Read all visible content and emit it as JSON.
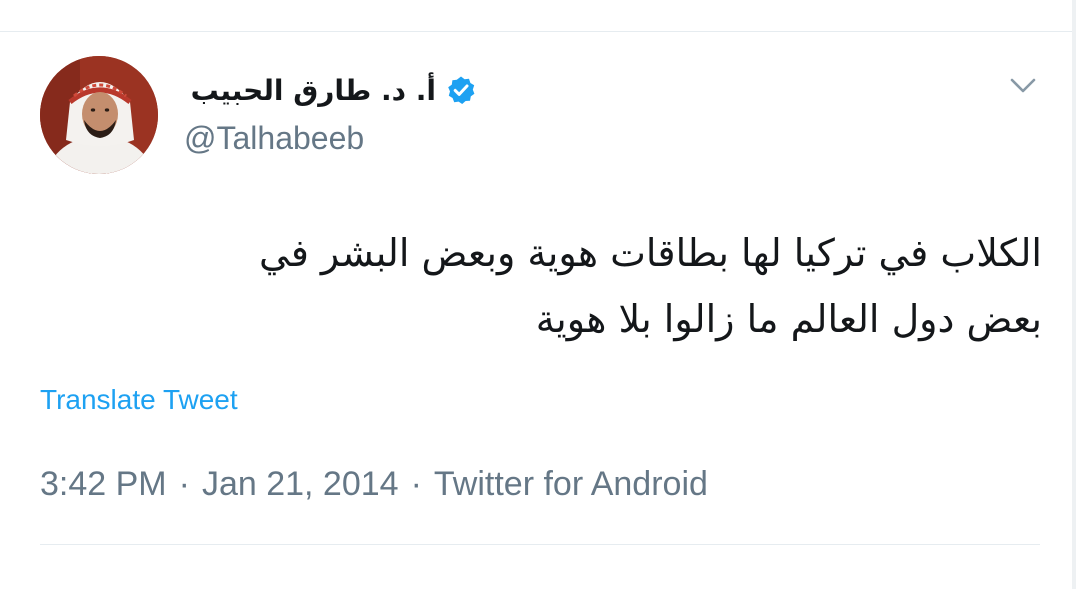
{
  "tweet": {
    "author": {
      "display_name": "أ. د. طارق الحبيب",
      "handle": "@Talhabeeb",
      "verified_icon": "verified-badge-icon",
      "avatar": "avatar-photo"
    },
    "text_lines": [
      "الكلاب في تركيا لها بطاقات هوية وبعض البشر في",
      "بعض دول العالم ما زالوا بلا هوية"
    ],
    "translate_label": "Translate Tweet",
    "time": "3:42 PM",
    "date": "Jan 21, 2014",
    "separator": "·",
    "source": "Twitter for Android",
    "menu_icon": "chevron-down-icon"
  },
  "colors": {
    "link": "#1da1f2",
    "secondary_text": "#657786",
    "primary_text": "#14171a",
    "divider": "#e6ecf0",
    "verified": "#1da1f2"
  }
}
